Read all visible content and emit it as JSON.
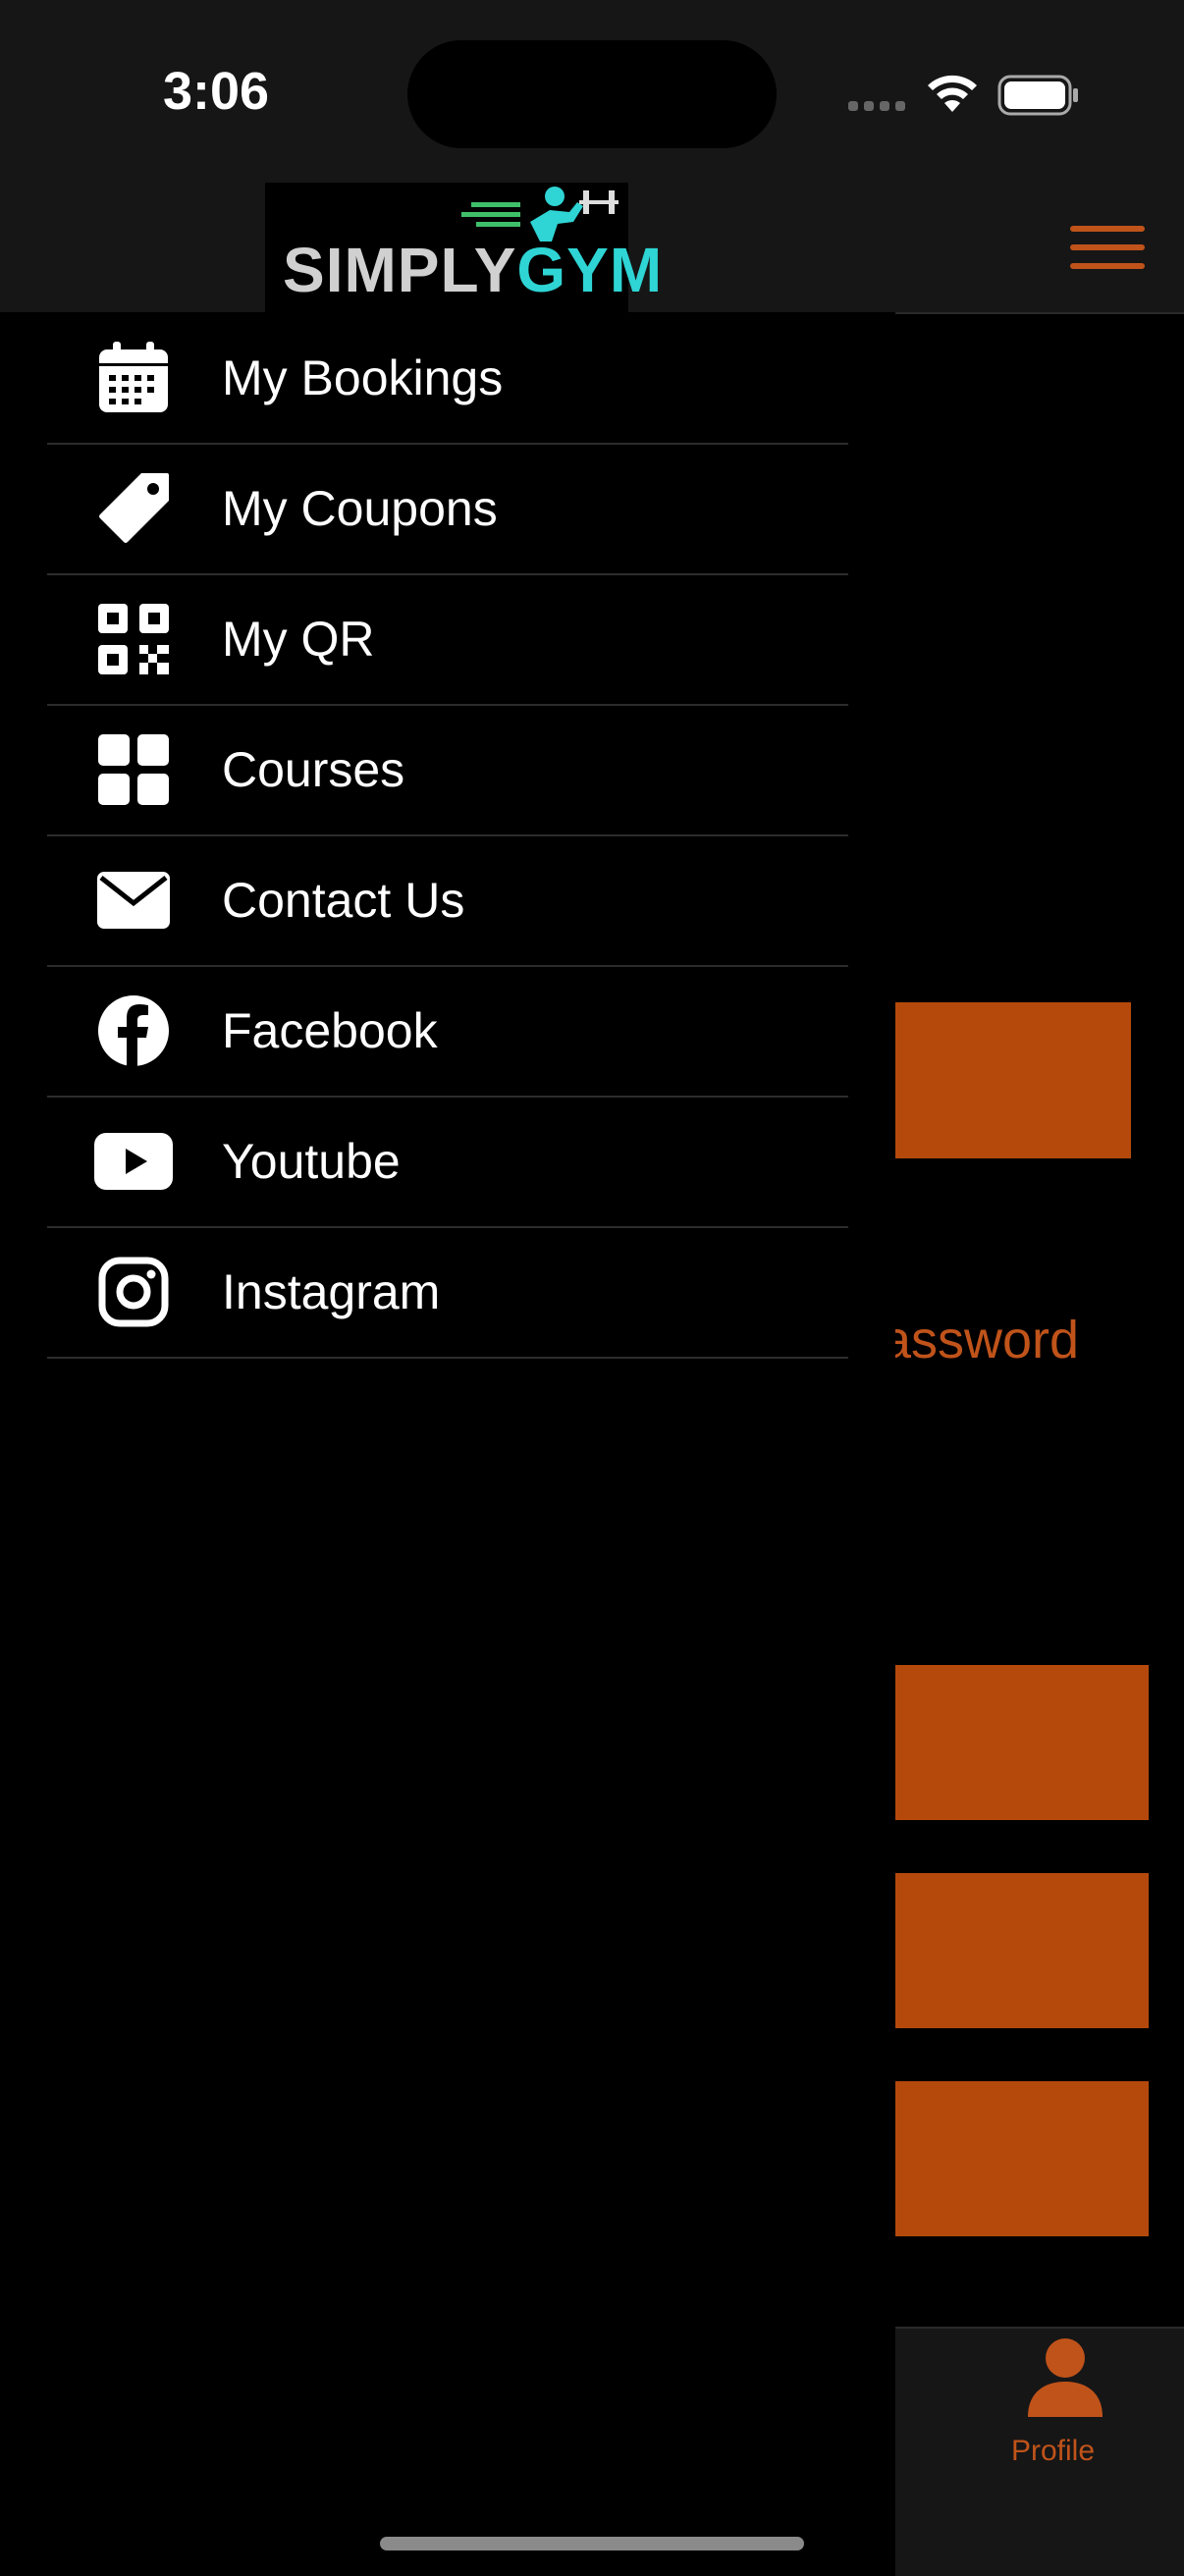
{
  "status": {
    "time": "3:06"
  },
  "logo": {
    "part1": "SIMPLY",
    "part2": "GYM"
  },
  "menu": {
    "items": [
      {
        "label": "My Bookings",
        "icon": "calendar-icon"
      },
      {
        "label": "My Coupons",
        "icon": "tag-icon"
      },
      {
        "label": "My QR",
        "icon": "qr-code-icon"
      },
      {
        "label": "Courses",
        "icon": "grid-icon"
      },
      {
        "label": "Contact Us",
        "icon": "envelope-icon"
      },
      {
        "label": "Facebook",
        "icon": "facebook-icon"
      },
      {
        "label": "Youtube",
        "icon": "youtube-icon"
      },
      {
        "label": "Instagram",
        "icon": "instagram-icon"
      }
    ]
  },
  "background": {
    "forgot_password_fragment": "assword",
    "tab_profile_label": "Profile"
  },
  "colors": {
    "accent": "#b5490c",
    "accent_text": "#c0531a",
    "bar_bg": "#161616"
  }
}
